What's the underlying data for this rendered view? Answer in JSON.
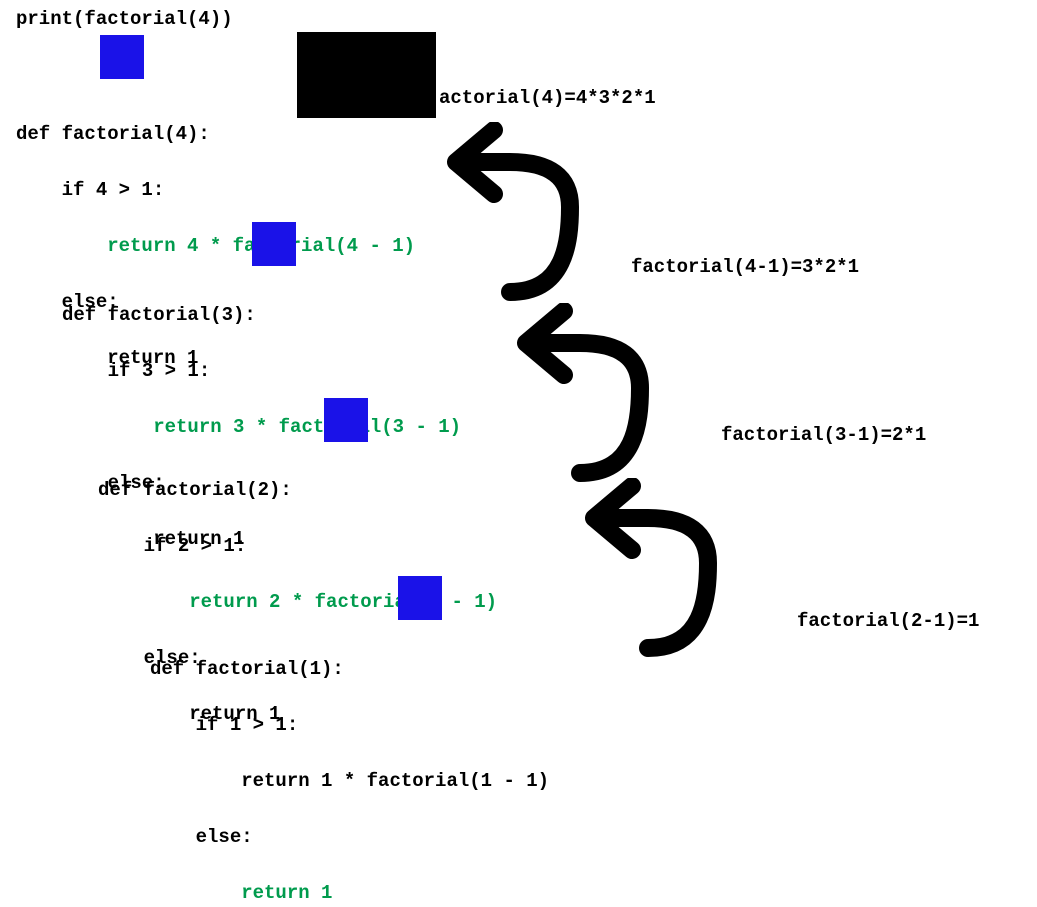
{
  "header_line": "print(factorial(4))",
  "blocks": [
    {
      "lines": [
        {
          "text": "def factorial(4):",
          "green": false
        },
        {
          "text": "    if 4 > 1:",
          "green": false
        },
        {
          "text": "        return 4 * factorial(4 - 1)",
          "green": true
        },
        {
          "text": "    else:",
          "green": false
        },
        {
          "text": "        return 1",
          "green": false
        }
      ]
    },
    {
      "lines": [
        {
          "text": "def factorial(3):",
          "green": false
        },
        {
          "text": "    if 3 > 1:",
          "green": false
        },
        {
          "text": "        return 3 * factorial(3 - 1)",
          "green": true
        },
        {
          "text": "    else:",
          "green": false
        },
        {
          "text": "        return 1",
          "green": false
        }
      ]
    },
    {
      "lines": [
        {
          "text": "def factorial(2):",
          "green": false
        },
        {
          "text": "    if 2 > 1:",
          "green": false
        },
        {
          "text": "        return 2 * factorial(2 - 1)",
          "green": true
        },
        {
          "text": "    else:",
          "green": false
        },
        {
          "text": "        return 1",
          "green": false
        }
      ]
    },
    {
      "lines": [
        {
          "text": "def factorial(1):",
          "green": false
        },
        {
          "text": "    if 1 > 1:",
          "green": false
        },
        {
          "text": "        return 1 * factorial(1 - 1)",
          "green": false
        },
        {
          "text": "    else:",
          "green": false
        },
        {
          "text": "        return 1",
          "green": true
        }
      ]
    }
  ],
  "annotations": [
    "actorial(4)=4*3*2*1",
    "factorial(4-1)=3*2*1",
    "factorial(3-1)=2*1",
    "factorial(2-1)=1"
  ]
}
